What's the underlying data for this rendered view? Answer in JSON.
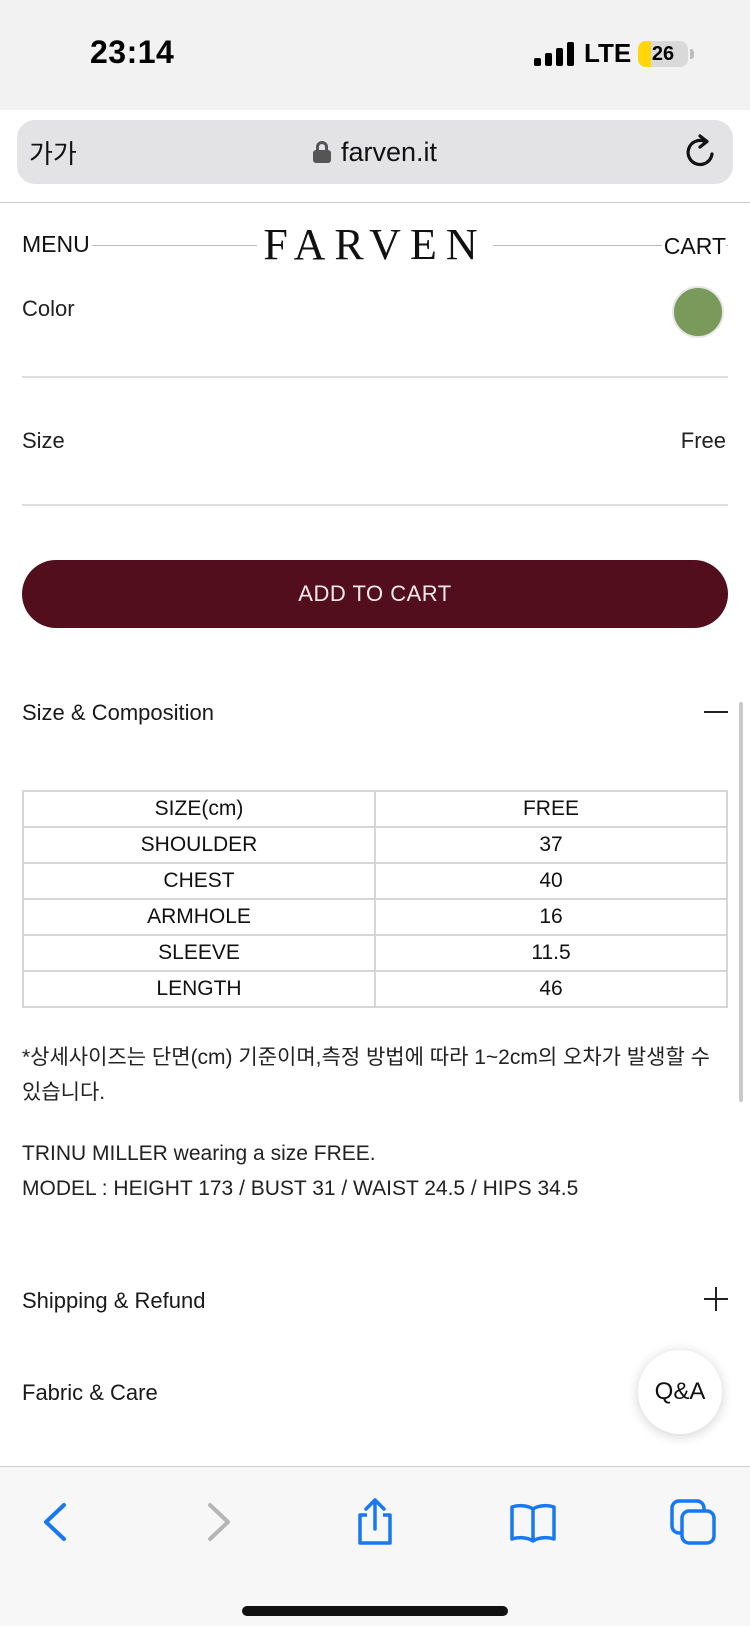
{
  "status_bar": {
    "time": "23:14",
    "network": "LTE",
    "battery": "26",
    "battery_level": 0.26,
    "battery_color": "#ffd60a"
  },
  "browser": {
    "text_size_button": "가가",
    "url": "farven.it",
    "toolbar_icons": [
      "back-icon",
      "forward-icon",
      "share-icon",
      "bookmarks-icon",
      "tabs-icon"
    ]
  },
  "header": {
    "menu": "MENU",
    "brand": "FARVEN",
    "cart": "CART"
  },
  "options": {
    "color_label": "Color",
    "color_swatch": "#7a9a5c",
    "size_label": "Size",
    "size_value": "Free"
  },
  "add_to_cart": {
    "label": "ADD TO CART",
    "color": "#520e1d"
  },
  "sections": {
    "size_composition": {
      "title": "Size & Composition"
    },
    "shipping_refund": {
      "title": "Shipping & Refund"
    },
    "fabric_care": {
      "title": "Fabric & Care"
    }
  },
  "size_table": {
    "header": [
      "SIZE(cm)",
      "FREE"
    ],
    "rows": [
      [
        "SHOULDER",
        "37"
      ],
      [
        "CHEST",
        "40"
      ],
      [
        "ARMHOLE",
        "16"
      ],
      [
        "SLEEVE",
        "11.5"
      ],
      [
        "LENGTH",
        "46"
      ]
    ]
  },
  "notes": {
    "size_note": "*상세사이즈는 단면(cm) 기준이며,측정 방법에 따라 1~2cm의 오차가 발생할 수 있습니다.",
    "model_wearing": "TRINU MILLER wearing a size FREE.",
    "model_measurements": "MODEL : HEIGHT 173 / BUST 31 / WAIST 24.5 / HIPS 34.5"
  },
  "qa_button": {
    "label": "Q&A"
  }
}
